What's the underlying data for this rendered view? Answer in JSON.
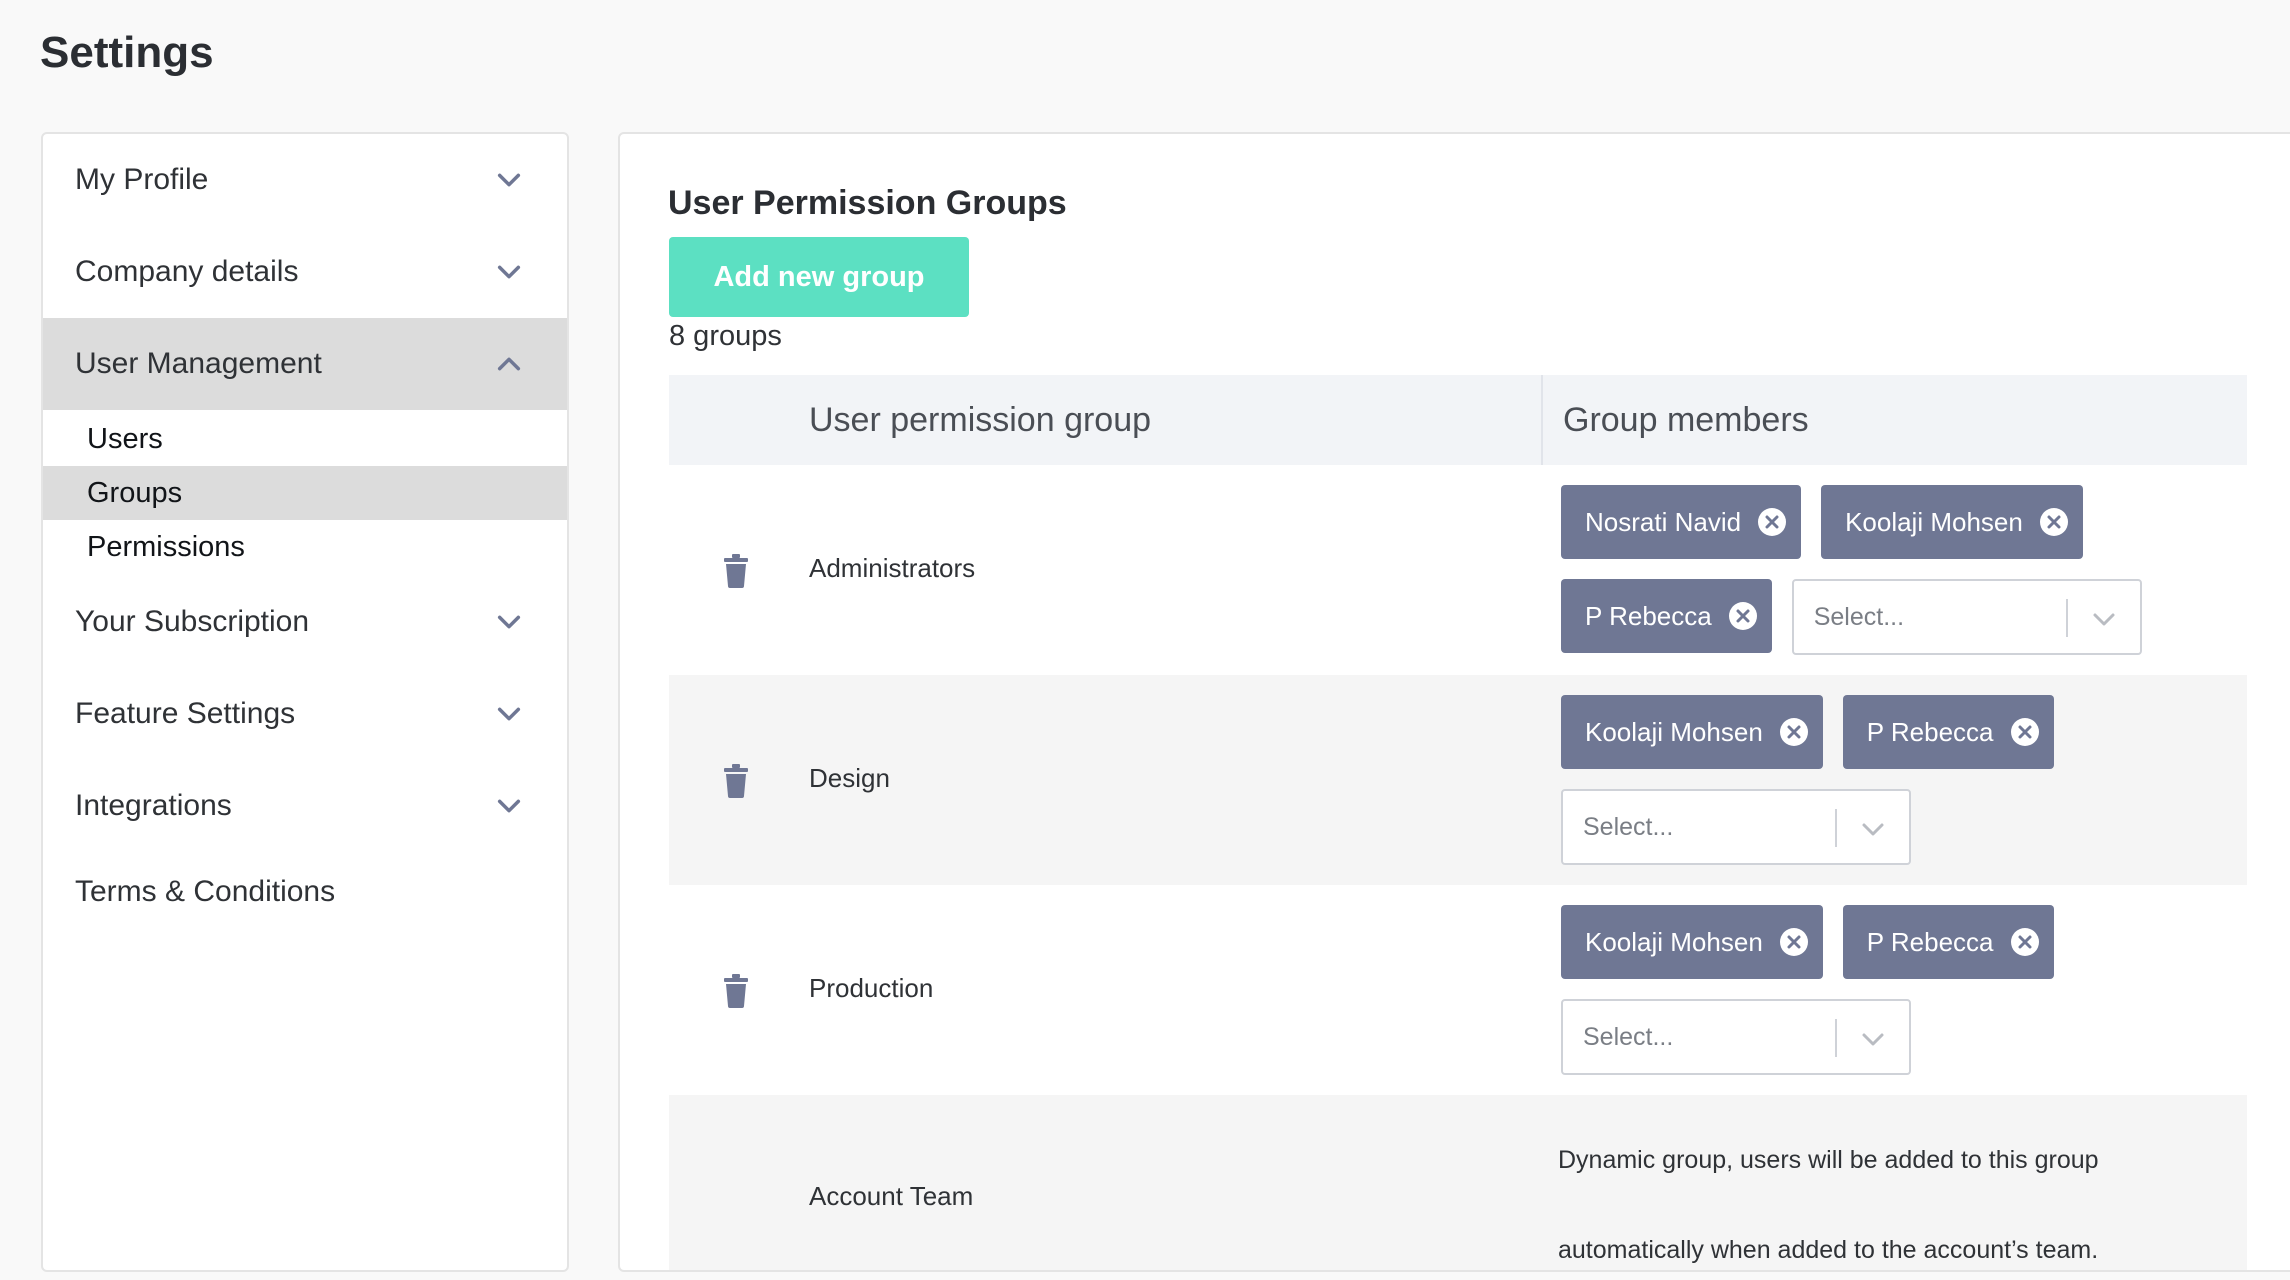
{
  "page": {
    "title": "Settings"
  },
  "sidebar": {
    "items": [
      {
        "label": "My Profile"
      },
      {
        "label": "Company details"
      },
      {
        "label": "User Management"
      },
      {
        "label": "Your Subscription"
      },
      {
        "label": "Feature Settings"
      },
      {
        "label": "Integrations"
      },
      {
        "label": "Terms & Conditions"
      }
    ],
    "user_management_sub": [
      {
        "label": "Users"
      },
      {
        "label": "Groups"
      },
      {
        "label": "Permissions"
      }
    ]
  },
  "main": {
    "section_title": "User Permission Groups",
    "add_button": "Add new group",
    "count": "8 groups",
    "table": {
      "headers": {
        "group": "User permission group",
        "members": "Group members"
      },
      "rows": [
        {
          "name": "Administrators",
          "members": [
            "Nosrati Navid",
            "Koolaji Mohsen",
            "P Rebecca"
          ],
          "select_placeholder": "Select..."
        },
        {
          "name": "Design",
          "members": [
            "Koolaji Mohsen",
            "P Rebecca"
          ],
          "select_placeholder": "Select..."
        },
        {
          "name": "Production",
          "members": [
            "Koolaji Mohsen",
            "P Rebecca"
          ],
          "select_placeholder": "Select..."
        },
        {
          "name": "Account Team",
          "dynamic_line1": "Dynamic group, users will be added to this group",
          "dynamic_line2": "automatically when added to the account’s team."
        }
      ]
    }
  },
  "colors": {
    "accent": "#5ce0c2",
    "tag": "#6f7794",
    "active_nav": "#dcdcdc",
    "header_bg": "#f2f4f7"
  },
  "icons": {
    "chevron": "chevron-down-icon",
    "chevron_up": "chevron-up-icon",
    "trash": "trash-icon",
    "remove": "close-circle-icon"
  }
}
